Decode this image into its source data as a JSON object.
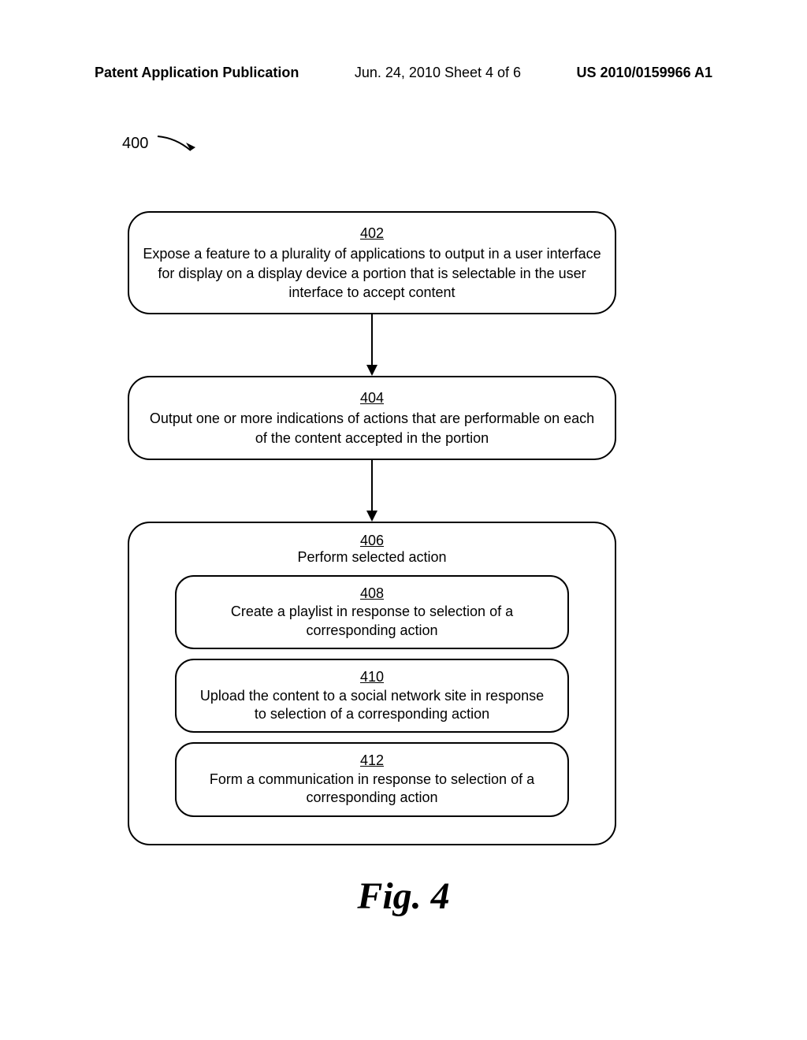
{
  "header": {
    "left": "Patent Application Publication",
    "center": "Jun. 24, 2010  Sheet 4 of 6",
    "right": "US 2010/0159966 A1"
  },
  "figureRef": "400",
  "steps": {
    "s402": {
      "num": "402",
      "text": "Expose a feature to a plurality of applications to output in a user interface for display on a display device a portion that is selectable in the user interface to accept content"
    },
    "s404": {
      "num": "404",
      "text": "Output one or more indications of actions that are performable on each of the content accepted in the portion"
    },
    "s406": {
      "num": "406",
      "text": "Perform selected action"
    },
    "s408": {
      "num": "408",
      "text": "Create a playlist in response to selection of a corresponding action"
    },
    "s410": {
      "num": "410",
      "text": "Upload the content to a social network site in response to selection of a corresponding action"
    },
    "s412": {
      "num": "412",
      "text": "Form a communication in response to selection of a corresponding action"
    }
  },
  "caption": "Fig. 4"
}
